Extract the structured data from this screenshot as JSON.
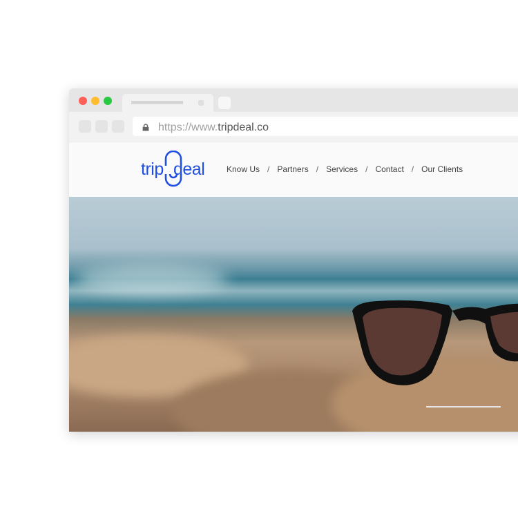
{
  "browser": {
    "url_prefix": "https://www.",
    "url_domain": "tripdeal.co",
    "traffic_lights": [
      "#fe5f57",
      "#febc2e",
      "#28c840"
    ]
  },
  "site": {
    "logo_text": "tripdeal",
    "brand_color": "#1f4fe0",
    "nav": [
      {
        "label": "Know Us"
      },
      {
        "label": "Partners"
      },
      {
        "label": "Services"
      },
      {
        "label": "Contact"
      },
      {
        "label": "Our Clients"
      }
    ],
    "nav_separator": "/"
  },
  "hero": {
    "slider_progress": 0.7
  }
}
